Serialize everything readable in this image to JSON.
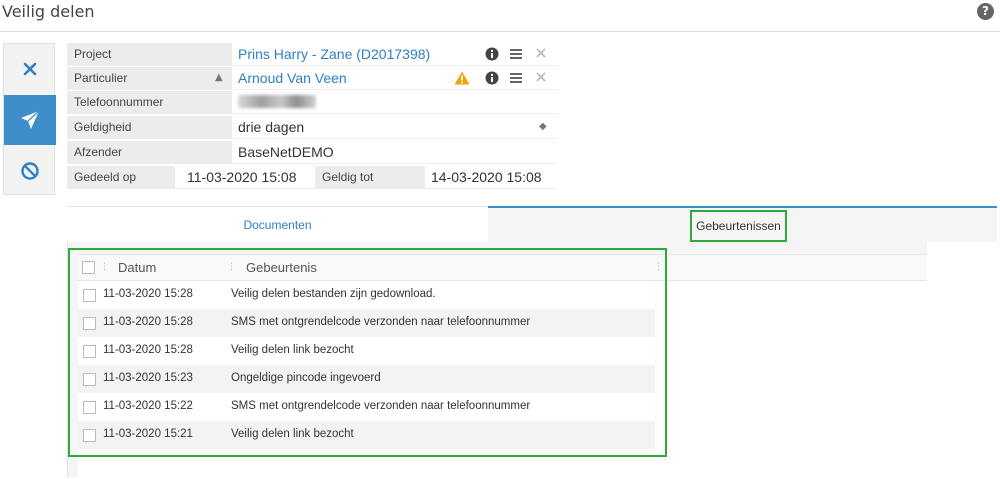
{
  "page": {
    "title": "Veilig delen",
    "help_glyph": "?"
  },
  "toolbar": {
    "buttons": [
      {
        "icon": "close-icon",
        "state": "normal"
      },
      {
        "icon": "send-icon",
        "state": "active"
      },
      {
        "icon": "cancel-icon",
        "state": "normal"
      }
    ]
  },
  "form": {
    "project": {
      "label": "Project",
      "value": "Prins Harry - Zane  (D2017398)"
    },
    "particulier": {
      "label": "Particulier",
      "value": "Arnoud Van Veen"
    },
    "telefoonnummer": {
      "label": "Telefoonnummer"
    },
    "geldigheid": {
      "label": "Geldigheid",
      "value": "drie dagen"
    },
    "afzender": {
      "label": "Afzender",
      "value": "BaseNetDEMO"
    },
    "gedeeld_op": {
      "label": "Gedeeld op",
      "value": "11-03-2020 15:08"
    },
    "geldig_tot": {
      "label": "Geldig tot",
      "value": "14-03-2020 15:08"
    }
  },
  "tabs": {
    "documenten": "Documenten",
    "gebeurtenissen": "Gebeurtenissen",
    "active": "Gebeurtenissen"
  },
  "grid": {
    "columns": {
      "date": "Datum",
      "event": "Gebeurtenis"
    },
    "rows": [
      {
        "date": "11-03-2020 15:28",
        "event": "Veilig delen bestanden zijn gedownload."
      },
      {
        "date": "11-03-2020 15:28",
        "event": "SMS met ontgrendelcode verzonden naar telefoonnummer"
      },
      {
        "date": "11-03-2020 15:28",
        "event": "Veilig delen link bezocht"
      },
      {
        "date": "11-03-2020 15:23",
        "event": "Ongeldige pincode ingevoerd"
      },
      {
        "date": "11-03-2020 15:22",
        "event": "SMS met ontgrendelcode verzonden naar telefoonnummer"
      },
      {
        "date": "11-03-2020 15:21",
        "event": "Veilig delen link bezocht"
      }
    ]
  },
  "colors": {
    "accent": "#3d8ec9",
    "link": "#2e7fc3",
    "highlight": "#2eaa3a",
    "warning": "#f0a30a"
  }
}
